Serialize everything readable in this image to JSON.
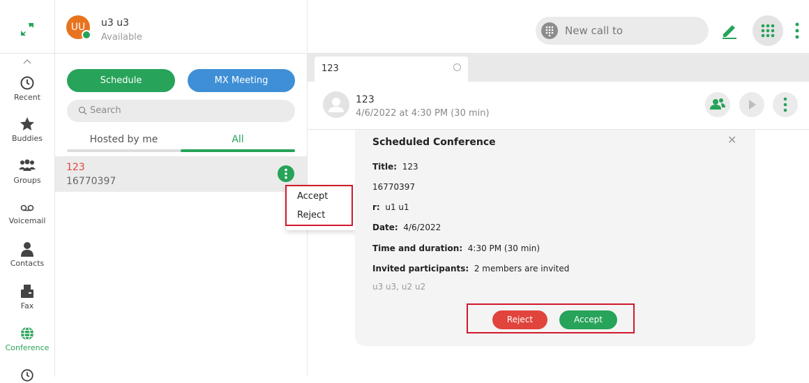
{
  "nav": {
    "items": [
      {
        "label": "Recent"
      },
      {
        "label": "Buddies"
      },
      {
        "label": "Groups"
      },
      {
        "label": "Voicemail"
      },
      {
        "label": "Contacts"
      },
      {
        "label": "Fax"
      },
      {
        "label": "Conference"
      }
    ],
    "active": "Conference",
    "accent": "#27a35a"
  },
  "user": {
    "initials": "UU",
    "name": "u3 u3",
    "status": "Available"
  },
  "actions": {
    "schedule": "Schedule",
    "mx_meeting": "MX Meeting"
  },
  "search": {
    "placeholder": "Search"
  },
  "tabs": {
    "hosted": "Hosted by me",
    "all": "All",
    "selected": "All"
  },
  "list": [
    {
      "title": "123",
      "number": "16770397"
    }
  ],
  "context_menu": {
    "accept": "Accept",
    "reject": "Reject"
  },
  "toolbar": {
    "new_call_placeholder": "New call to"
  },
  "doc_tab": {
    "label": "123"
  },
  "conversation": {
    "name": "123",
    "subtitle": "4/6/2022 at 4:30 PM (30 min)"
  },
  "conference": {
    "heading": "Scheduled Conference",
    "title_label": "Title:",
    "title_value": "123",
    "number_value": "16770397",
    "owner_label": "r:",
    "owner_value": "u1 u1",
    "date_label": "Date:",
    "date_value": "4/6/2022",
    "time_label": "Time and duration:",
    "time_value": "4:30 PM (30 min)",
    "invited_label": "Invited participants:",
    "invited_value": "2 members are invited",
    "participants": "u3 u3, u2 u2",
    "reject": "Reject",
    "accept": "Accept"
  },
  "colors": {
    "green": "#27a35a",
    "blue": "#3f8fd6",
    "red": "#e0443d",
    "highlight": "#d0182b"
  }
}
